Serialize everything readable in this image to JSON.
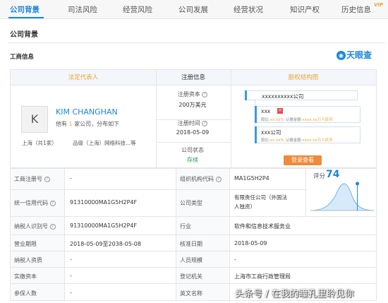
{
  "tabs": [
    {
      "label": "公司背景",
      "active": true
    },
    {
      "label": "司法风险",
      "active": false
    },
    {
      "label": "经营风险",
      "active": false
    },
    {
      "label": "公司发展",
      "active": false
    },
    {
      "label": "经营状况",
      "active": false
    },
    {
      "label": "知识产权",
      "active": false
    },
    {
      "label": "历史信息",
      "active": false,
      "badge": "VIP"
    }
  ],
  "section_title": "公司背景",
  "subsection_title": "工商信息",
  "brand_logo": "天眼查",
  "header": {
    "legal_rep": "法定代表人",
    "registration": "注册信息",
    "shareholding": "股权结构图"
  },
  "legal_rep": {
    "avatar_letter": "K",
    "name": "KIM CHANGHAN",
    "holds_prefix": "他有",
    "holds_count": "1",
    "holds_suffix": "家公司，分布如下",
    "location": "上海（共1家）",
    "company": "品级（上海）网络科技...等"
  },
  "registration": {
    "capital_label": "注册资本",
    "capital_value": "200万美元",
    "date_label": "注册时间",
    "date_value": "2018-05-09",
    "status_label": "公司状态",
    "status_value": "存续"
  },
  "shareholding": {
    "root": "xxxxxxxxxx公司",
    "holders": [
      {
        "name": "xxx",
        "detail_prefix": "股比:",
        "ratio": "xx.xx%",
        "mid": "认缴金额:",
        "amount": "xxxx.xx万人民币"
      },
      {
        "name": "xxx公司",
        "detail_prefix": "股比:",
        "ratio": "xx.xx%",
        "mid": "认缴金额:",
        "amount": "xxxx.xx万人民币"
      }
    ],
    "login_button": "登录查看"
  },
  "details": [
    {
      "l1": "工商注册号",
      "v1": "-",
      "l2": "组织机构代码",
      "v2": "MA1G5H2P4"
    },
    {
      "l1": "统一信用代码",
      "v1": "91310000MA1G5H2P4F",
      "l2": "公司类型",
      "v2": "有限责任公司（外国法",
      "v2b": "人独资）"
    },
    {
      "l1": "纳税人识别号",
      "v1": "91310000MA1G5H2P4F",
      "l2": "行业",
      "v2": "软件和信息技术服务业"
    },
    {
      "l1": "营业期限",
      "v1": "2018-05-09至2038-05-08",
      "l2": "核准日期",
      "v2": "2018-05-09"
    },
    {
      "l1": "纳税人资质",
      "v1": "-",
      "l2": "人员规模",
      "v2": "-"
    },
    {
      "l1": "实缴资本",
      "v1": "-",
      "l2": "登记机关",
      "v2": "上海市工商行政管理局"
    },
    {
      "l1": "参保人数",
      "v1": "-",
      "l2": "英文名称",
      "v2": ""
    }
  ],
  "score": {
    "label": "评分",
    "value": "74",
    "value_number": 74
  },
  "watermark": "头条号 / 在我的瞳孔里聆见你",
  "colors": {
    "accent": "#1a87db",
    "orange": "#f08a3c",
    "status_green": "#2a9d4a",
    "header_bg": "#f3f6fa"
  }
}
